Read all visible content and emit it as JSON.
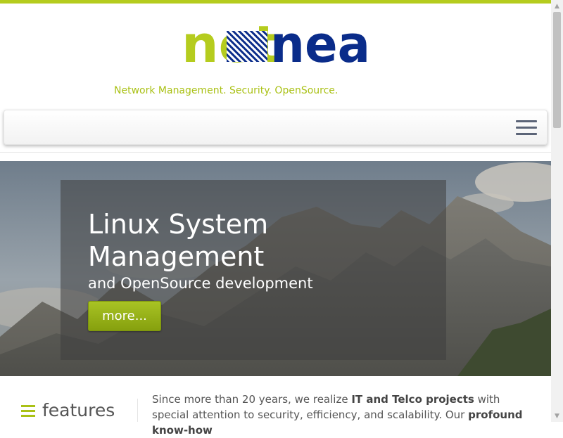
{
  "brand": {
    "logo_text_left": "net",
    "logo_text_right": "nea",
    "tagline": "Network Management. Security. OpenSource.",
    "colors": {
      "green": "#b5cc1e",
      "blue": "#0a2c8a"
    }
  },
  "navbar": {
    "menu_icon": "hamburger-menu-icon"
  },
  "hero": {
    "title_line1": "Linux System",
    "title_line2": "Management",
    "subtitle": "and OpenSource development",
    "button_label": "more..."
  },
  "content": {
    "section_icon": "list-icon",
    "section_title": "features",
    "intro": {
      "part1": "Since more than 20 years, we realize ",
      "bold1": "IT and Telco projects",
      "part2": " with special attention to security, efficiency, and scalability. Our ",
      "bold2": "profound know-how"
    }
  }
}
